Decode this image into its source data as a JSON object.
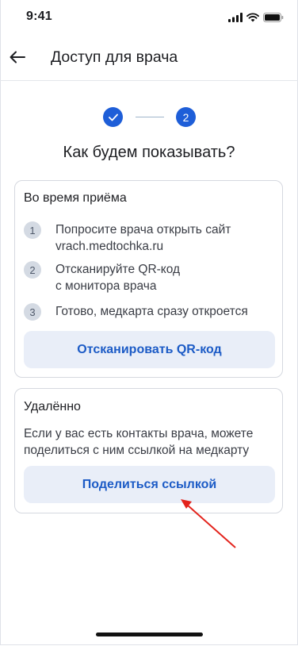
{
  "status_bar": {
    "time": "9:41"
  },
  "header": {
    "title": "Доступ для врача"
  },
  "stepper": {
    "step1_icon": "check-icon",
    "step2_number": "2"
  },
  "question": "Как будем показывать?",
  "in_person": {
    "title": "Во время приёма",
    "steps": [
      {
        "number": "1",
        "line1": "Попросите врача открыть сайт",
        "line2": "vrach.medtochka.ru"
      },
      {
        "number": "2",
        "line1": "Отсканируйте QR-код",
        "line2": "с монитора врача"
      },
      {
        "number": "3",
        "line1": "Готово, медкарта сразу откроется",
        "line2": ""
      }
    ],
    "button_label": "Отсканировать QR-код"
  },
  "remote": {
    "title": "Удалённо",
    "description_line1": "Если у вас есть контакты врача, можете",
    "description_line2": "поделиться с ним ссылкой на медкарту",
    "button_label": "Поделиться ссылкой"
  },
  "colors": {
    "accent": "#1e5ed8",
    "button_bg": "#e9eef8",
    "button_text": "#1c5bc6",
    "annotation_arrow": "#e3231c"
  }
}
